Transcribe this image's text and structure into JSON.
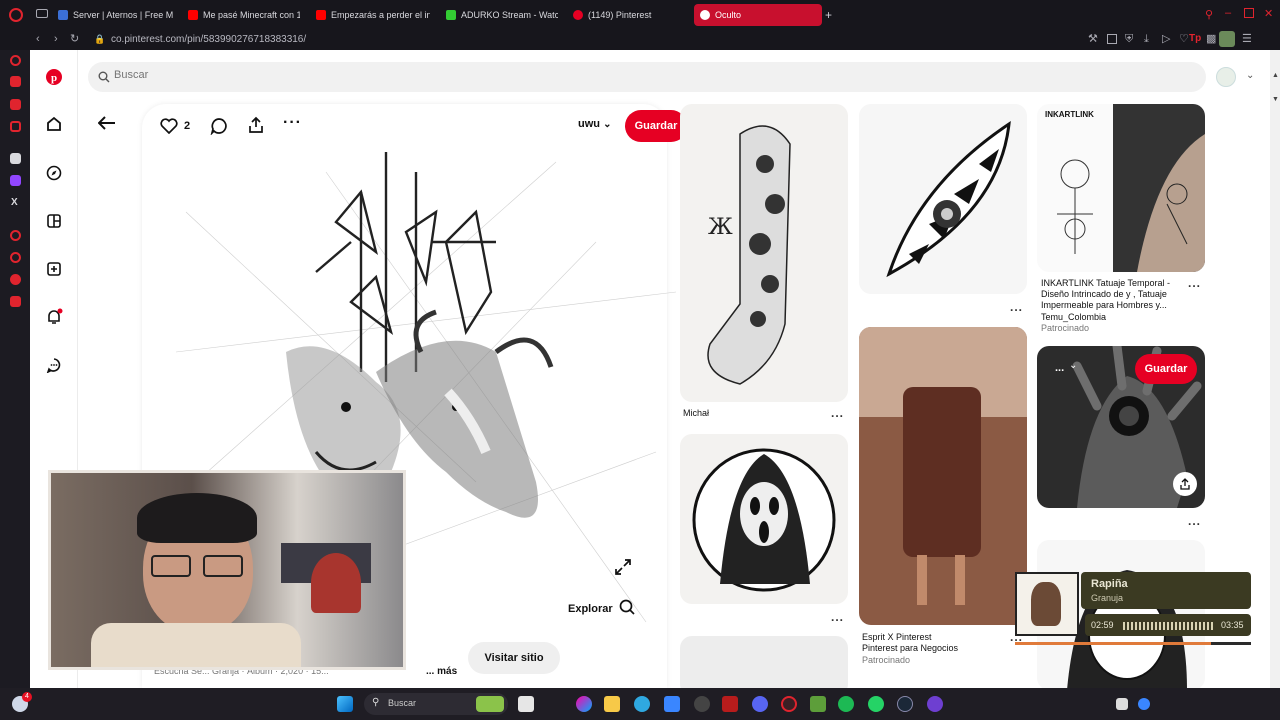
{
  "browser": {
    "tabs": [
      {
        "label": "Server | Aternos | Free M",
        "favicon_color": "#3b6fd6"
      },
      {
        "label": "Me pasé Minecraft con 1",
        "favicon_color": "#ff0000"
      },
      {
        "label": "Empezarás a perder el int",
        "favicon_color": "#ff0000"
      },
      {
        "label": "ADURKO Stream - Watch",
        "favicon_color": "#33cc33"
      },
      {
        "label": "(1149) Pinterest",
        "favicon_color": "#e60023"
      },
      {
        "label": "Oculto",
        "favicon_color": "#e60023"
      }
    ],
    "new_tab": "+",
    "url": "co.pinterest.com/pin/583990276718383316/"
  },
  "search": {
    "placeholder": "Buscar"
  },
  "pin": {
    "like_count": "2",
    "board": "uwu",
    "save_label": "Guardar",
    "explore_label": "Explorar",
    "visit_label": "Visitar sitio",
    "more_label": "... más",
    "caption_partial": "Escucha Se... Granja · Álbum · 2,020 · 15..."
  },
  "grid": {
    "col1": [
      {
        "caption": "Michał",
        "dots": "..."
      },
      {
        "caption": "",
        "dots": "..."
      }
    ],
    "col2": [
      {
        "caption": "",
        "dots": "..."
      },
      {
        "title": "Esprit X Pinterest",
        "subtitle": "Pinterest para Negocios",
        "tag": "Patrocinado",
        "dots": "..."
      }
    ],
    "col3": [
      {
        "brand": "INKARTLINK",
        "title": "INKARTLINK Tatuaje Temporal - Diseño Intrincado de y , Tatuaje Impermeable para Hombres y...",
        "subtitle": "Temu_Colombia",
        "tag": "Patrocinado",
        "dots": "..."
      },
      {
        "hover_save": "Guardar",
        "hover_board": "...",
        "dots": "..."
      }
    ]
  },
  "music": {
    "title": "Rapiña",
    "artist": "Granuja",
    "elapsed": "02:59",
    "total": "03:35",
    "progress": 0.83
  },
  "taskbar": {
    "search_placeholder": "Buscar",
    "badge_count": "4"
  },
  "colors": {
    "pinterest_red": "#e60023",
    "opera_red": "#c8102e",
    "chrome_bg": "#17161c",
    "music_bg": "#3b3a22"
  }
}
